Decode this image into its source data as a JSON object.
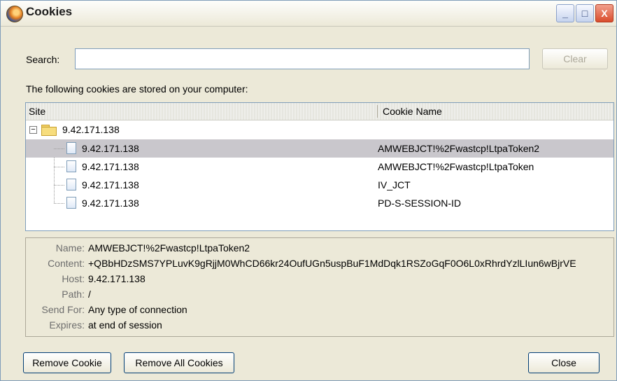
{
  "window": {
    "title": "Cookies",
    "minimize": "_",
    "maximize": "□",
    "close": "X"
  },
  "search": {
    "label": "Search:",
    "value": "",
    "placeholder": "",
    "clear_label": "Clear"
  },
  "info_text": "The following cookies are stored on your computer:",
  "tree": {
    "columns": {
      "site": "Site",
      "cookie_name": "Cookie Name"
    },
    "root": {
      "label": "9.42.171.138",
      "expander": "−"
    },
    "rows": [
      {
        "site": "9.42.171.138",
        "cookie_name": "AMWEBJCT!%2Fwastcp!LtpaToken2",
        "selected": true
      },
      {
        "site": "9.42.171.138",
        "cookie_name": "AMWEBJCT!%2Fwastcp!LtpaToken",
        "selected": false
      },
      {
        "site": "9.42.171.138",
        "cookie_name": "IV_JCT",
        "selected": false
      },
      {
        "site": "9.42.171.138",
        "cookie_name": "PD-S-SESSION-ID",
        "selected": false
      }
    ]
  },
  "details": {
    "name": {
      "label": "Name:",
      "value": "AMWEBJCT!%2Fwastcp!LtpaToken2"
    },
    "content": {
      "label": "Content:",
      "value": "+QBbHDzSMS7YPLuvK9gRjjM0WhCD66kr24OufUGn5uspBuF1MdDqk1RSZoGqF0O6L0xRhrdYzlLIun6wBjrVE"
    },
    "host": {
      "label": "Host:",
      "value": "9.42.171.138"
    },
    "path": {
      "label": "Path:",
      "value": "/"
    },
    "send_for": {
      "label": "Send For:",
      "value": "Any type of connection"
    },
    "expires": {
      "label": "Expires:",
      "value": "at end of session"
    }
  },
  "buttons": {
    "remove_cookie": "Remove Cookie",
    "remove_all": "Remove All Cookies",
    "close": "Close"
  },
  "colors": {
    "selection": "#c9c7cc",
    "window_bg": "#ece9d8",
    "border": "#7f9db9"
  }
}
